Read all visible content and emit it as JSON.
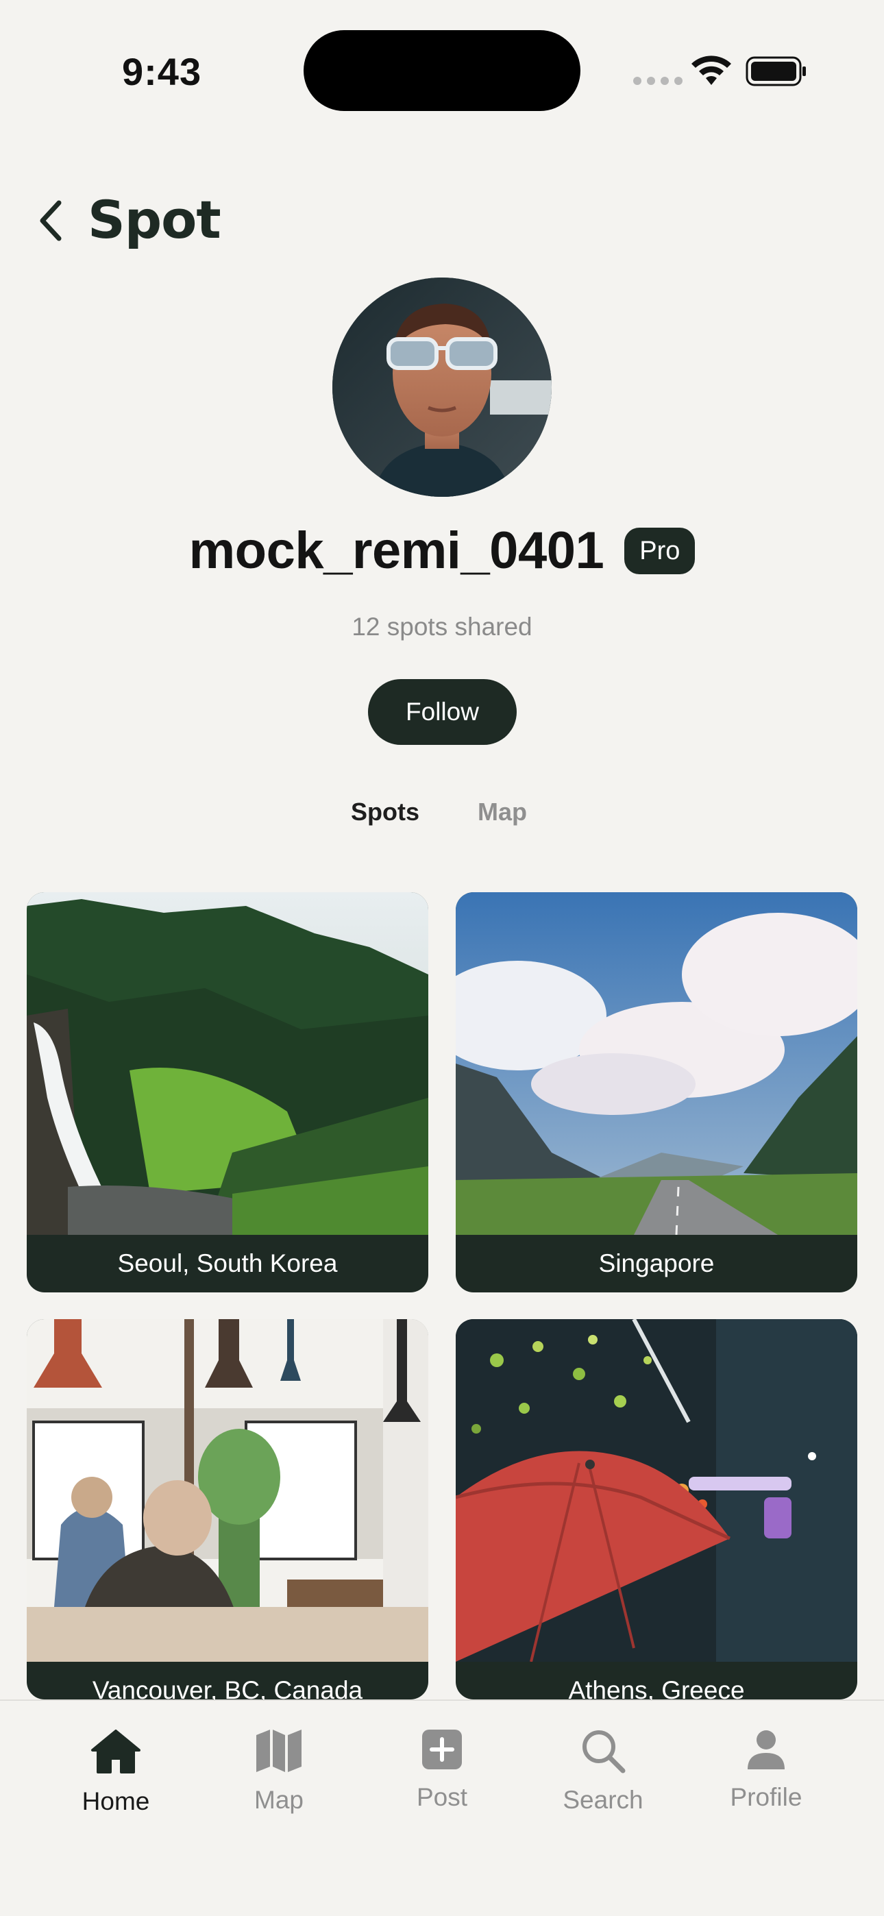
{
  "status_bar": {
    "time": "9:43"
  },
  "header": {
    "title": "Spot"
  },
  "profile": {
    "username": "mock_remi_0401",
    "badge": "Pro",
    "spots_shared": "12 spots shared",
    "follow_label": "Follow"
  },
  "tabs": [
    {
      "label": "Spots",
      "active": true
    },
    {
      "label": "Map",
      "active": false
    }
  ],
  "spots": [
    {
      "label": "Seoul, South Korea"
    },
    {
      "label": "Singapore"
    },
    {
      "label": "Vancouver, BC, Canada"
    },
    {
      "label": "Athens, Greece"
    }
  ],
  "bottom_nav": [
    {
      "label": "Home",
      "icon": "home-icon",
      "active": true
    },
    {
      "label": "Map",
      "icon": "map-icon",
      "active": false
    },
    {
      "label": "Post",
      "icon": "plus-square-icon",
      "active": false
    },
    {
      "label": "Search",
      "icon": "search-icon",
      "active": false
    },
    {
      "label": "Profile",
      "icon": "person-icon",
      "active": false
    }
  ],
  "colors": {
    "background": "#f4f3f0",
    "accent": "#1e2a24",
    "muted": "#8f8f8f"
  }
}
